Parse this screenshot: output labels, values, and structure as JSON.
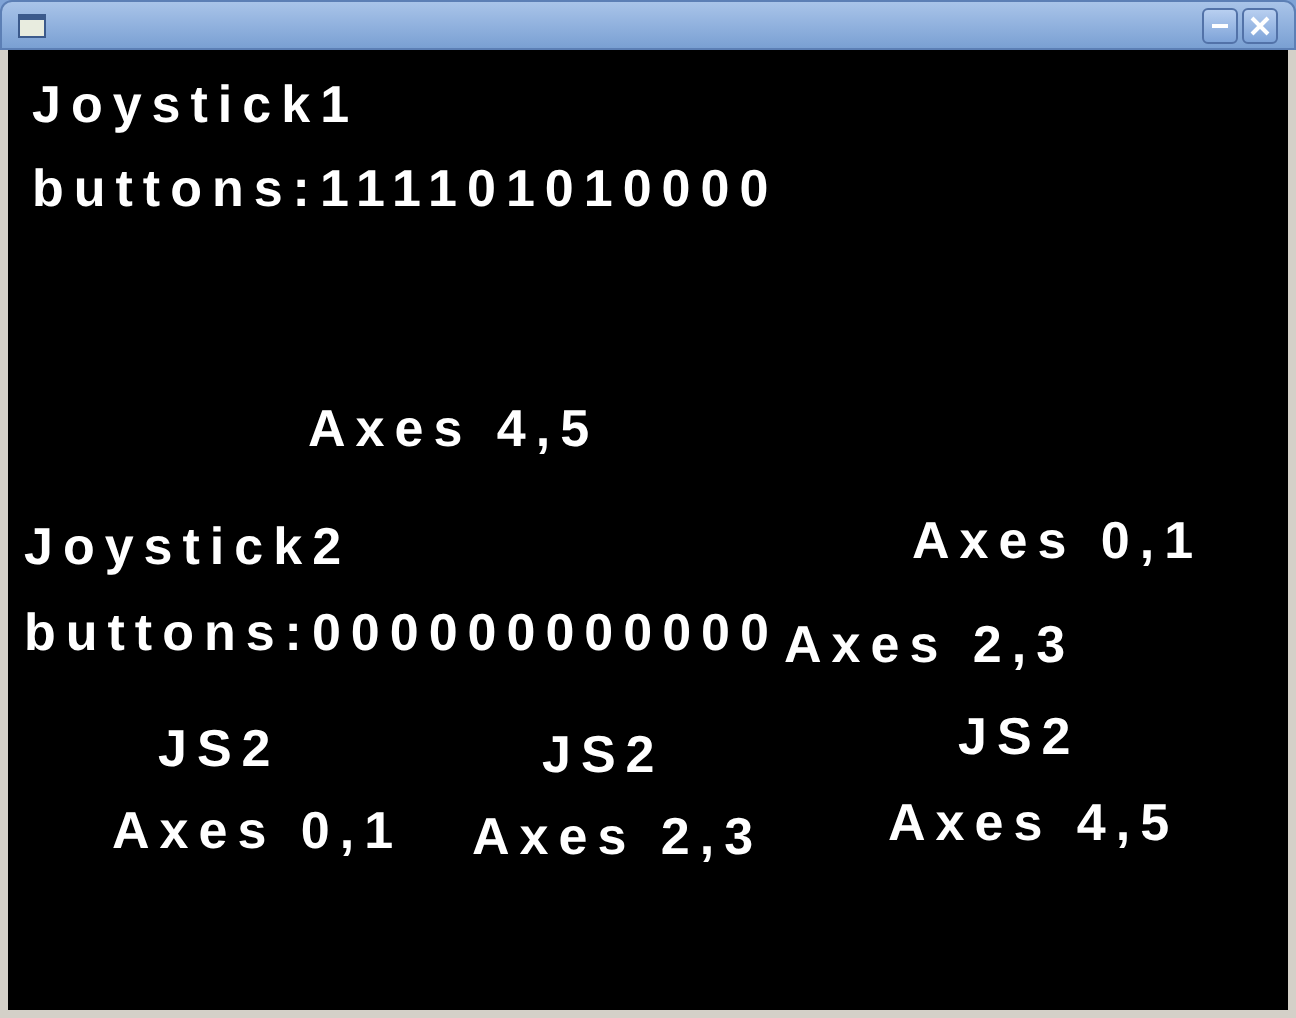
{
  "canvas": {
    "labels": [
      {
        "text": "Joystick1"
      },
      {
        "text": "buttons:111101010000"
      },
      {
        "text": "Axes 4,5"
      },
      {
        "text": "Joystick2"
      },
      {
        "text": "Axes 0,1"
      },
      {
        "text": "buttons:000000000000"
      },
      {
        "text": "Axes 2,3"
      },
      {
        "text": "JS2"
      },
      {
        "text": "JS2"
      },
      {
        "text": "JS2"
      },
      {
        "text": "Axes 0,1"
      },
      {
        "text": "Axes 2,3"
      },
      {
        "text": "Axes 4,5"
      }
    ]
  }
}
